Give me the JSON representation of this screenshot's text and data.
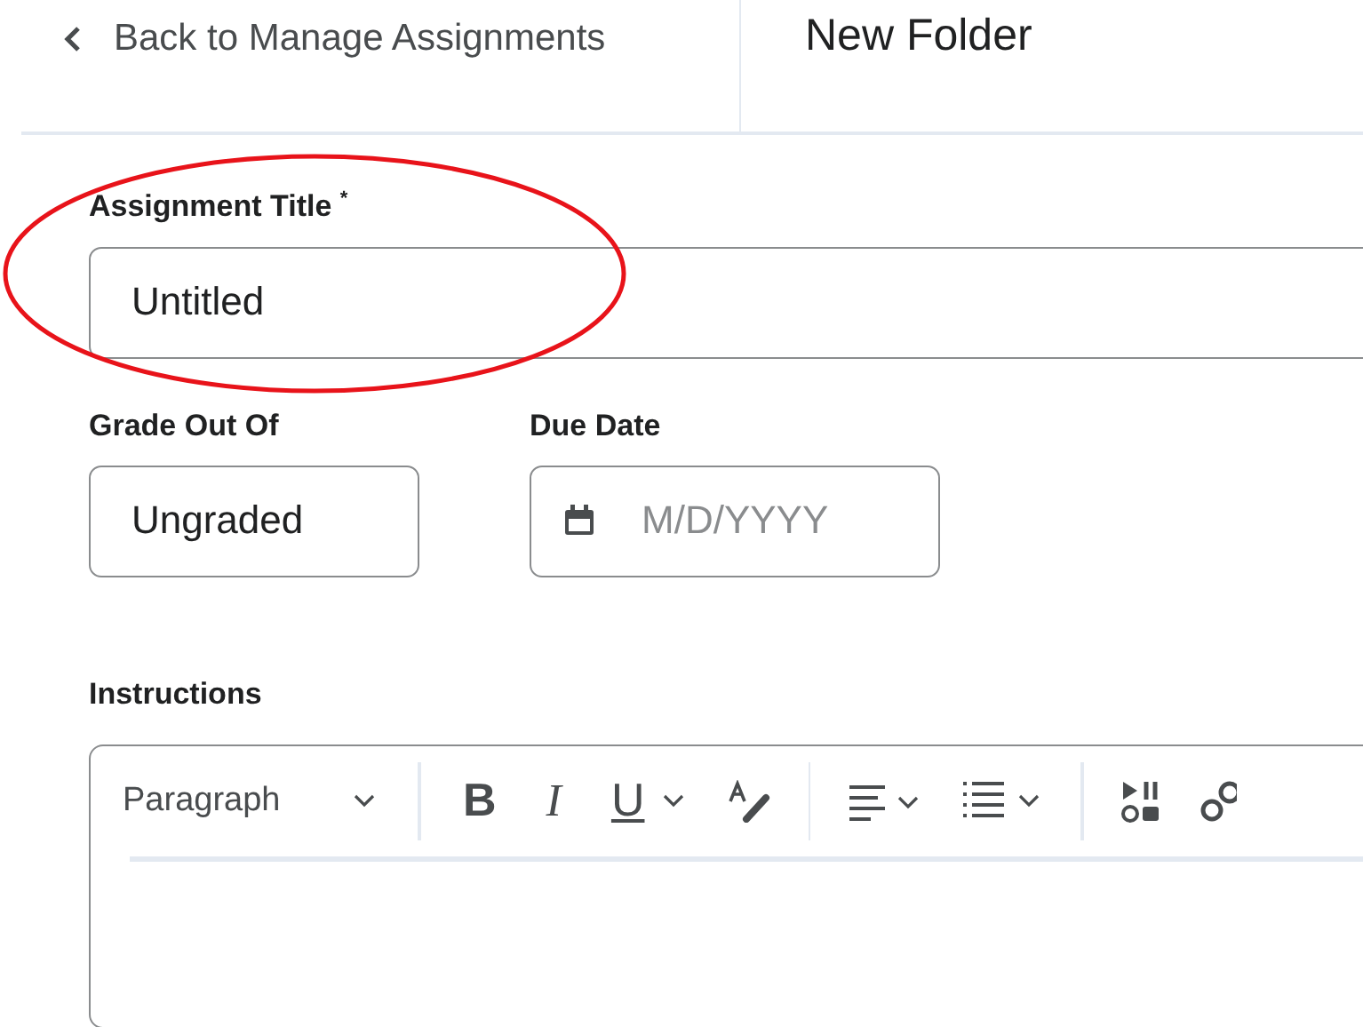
{
  "header": {
    "back_link": "Back to Manage Assignments",
    "title": "New Folder"
  },
  "title_field": {
    "label": "Assignment Title",
    "required_mark": "*",
    "value": "Untitled"
  },
  "grade_field": {
    "label": "Grade Out Of",
    "value": "Ungraded"
  },
  "due_date_field": {
    "label": "Due Date",
    "placeholder": "M/D/YYYY"
  },
  "instructions": {
    "label": "Instructions",
    "format_select": "Paragraph",
    "tools": [
      {
        "kind": "bold",
        "glyph": "B"
      },
      {
        "kind": "italic",
        "glyph": "I"
      },
      {
        "kind": "underline",
        "glyph": "U"
      },
      {
        "kind": "painter"
      },
      {
        "kind": "sep"
      },
      {
        "kind": "align"
      },
      {
        "kind": "list"
      },
      {
        "kind": "sep"
      },
      {
        "kind": "media"
      },
      {
        "kind": "link"
      }
    ]
  }
}
